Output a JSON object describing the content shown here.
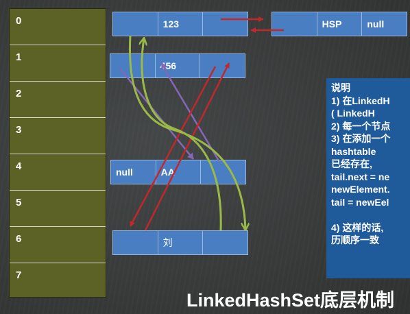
{
  "table": {
    "indices": [
      "0",
      "1",
      "2",
      "3",
      "4",
      "5",
      "6",
      "7"
    ]
  },
  "nodes": {
    "n123": [
      "",
      "123",
      ""
    ],
    "nhsp": [
      "",
      "HSP",
      "null"
    ],
    "n456": [
      "",
      "456",
      ""
    ],
    "naa": [
      "null",
      "AA",
      ""
    ],
    "nliu": [
      "",
      "刘",
      ""
    ]
  },
  "notes": {
    "heading": "说明",
    "lines": [
      "1)  在LinkedH",
      "     ( LinkedH",
      "2)  每一个节点",
      "3)  在添加一个",
      "     hashtable",
      "     已经存在,",
      "tail.next = ne",
      "newElement.",
      "tail = newEel",
      "",
      "4)  这样的话,",
      "     历顺序一致"
    ]
  },
  "title": "LinkedHashSet底层机制",
  "colors": {
    "arrow_red": "#c0282b",
    "arrow_green": "#9bb947",
    "arrow_purple": "#8666b8",
    "node": "#4a7ec2",
    "table": "#5c6226",
    "notes": "#1f5a9a"
  }
}
